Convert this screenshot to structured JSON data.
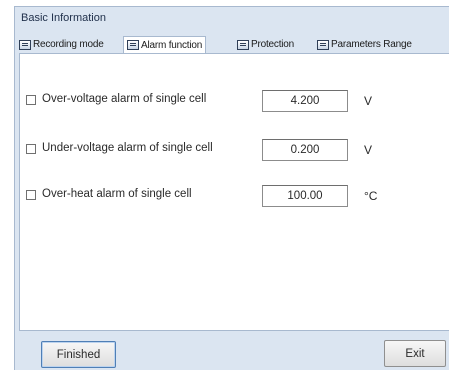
{
  "window": {
    "title": "Basic Information"
  },
  "tabs": [
    {
      "label": "Recording mode",
      "icon": "tab-icon",
      "active": false
    },
    {
      "label": "Alarm function",
      "icon": "tab-icon",
      "active": true
    },
    {
      "label": "Protection",
      "icon": "tab-icon",
      "active": false
    },
    {
      "label": "Parameters Range",
      "icon": "tab-icon",
      "active": false
    }
  ],
  "alarms": [
    {
      "label": "Over-voltage alarm of single cell",
      "value": "4.200",
      "unit": "V",
      "checked": false
    },
    {
      "label": "Under-voltage alarm of single cell",
      "value": "0.200",
      "unit": "V",
      "checked": false
    },
    {
      "label": "Over-heat alarm of single cell",
      "value": "100.00",
      "unit": "°C",
      "checked": false
    }
  ],
  "buttons": {
    "finished": "Finished",
    "exit": "Exit"
  },
  "colors": {
    "dialog_background": "#dbe5f1",
    "panel_background": "#ffffff",
    "focus_border": "#4f7fb6"
  }
}
